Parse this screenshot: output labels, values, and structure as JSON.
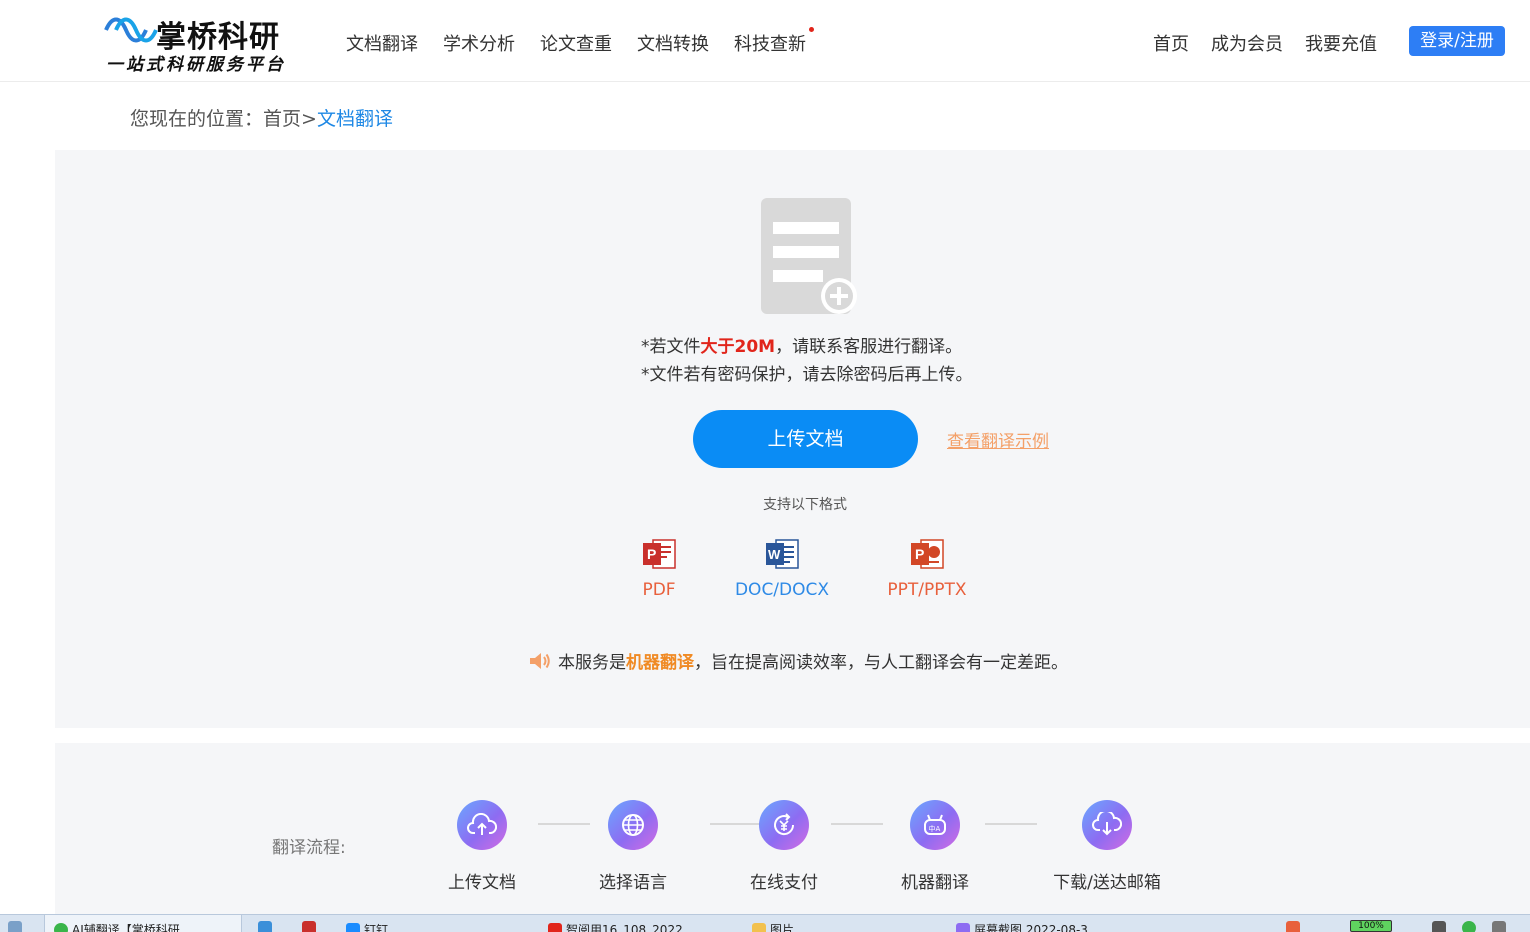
{
  "header": {
    "logo_title": "掌桥科研",
    "logo_subtitle": "一站式科研服务平台",
    "nav": [
      "文档翻译",
      "学术分析",
      "论文查重",
      "文档转换",
      "科技查新"
    ],
    "right_nav": [
      "首页",
      "成为会员",
      "我要充值"
    ],
    "login_label": "登录/注册"
  },
  "breadcrumb": {
    "prefix": "您现在的位置：",
    "home": "首页",
    "separator": ">",
    "current": "文档翻译"
  },
  "upload": {
    "note1_pre": "*若文件",
    "note1_highlight": "大于20M",
    "note1_post": "，请联系客服进行翻译。",
    "note2": "*文件若有密码保护，请去除密码后再上传。",
    "upload_button": "上传文档",
    "example_link": "查看翻译示例",
    "formats_title": "支持以下格式",
    "formats": [
      "PDF",
      "DOC/DOCX",
      "PPT/PPTX"
    ],
    "notice_pre": "本服务是",
    "notice_highlight": "机器翻译",
    "notice_post": "，旨在提高阅读效率，与人工翻译会有一定差距。"
  },
  "process": {
    "label": "翻译流程:",
    "steps": [
      "上传文档",
      "选择语言",
      "在线支付",
      "机器翻译",
      "下载/送达邮箱"
    ]
  },
  "taskbar": {
    "items": [
      "AI辅翻译【掌桥科研",
      "钉钉",
      "智阅用16_108_2022",
      "图片",
      "屏幕截图 2022-08-3"
    ],
    "battery": "100%"
  },
  "colors": {
    "primary_blue": "#0a8cf5",
    "login_blue": "#2d7ef5",
    "accent_red": "#e1251b",
    "accent_orange": "#f08a24",
    "link_orange": "#f4a068",
    "panel_bg": "#f5f6f8"
  }
}
